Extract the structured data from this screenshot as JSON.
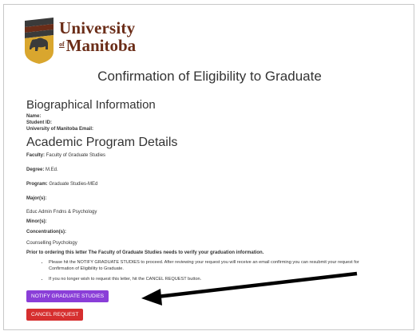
{
  "logo": {
    "line1": "University",
    "of": "of",
    "line2": "Manitoba",
    "colors": {
      "brown": "#6b2d18",
      "gold": "#d9a62e",
      "dark": "#333333"
    },
    "icon": "bison-crest-icon"
  },
  "page_title": "Confirmation of Eligibility to Graduate",
  "bio": {
    "heading": "Biographical Information",
    "name_label": "Name:",
    "student_id_label": "Student ID:",
    "email_label": "University of Manitoba Email:"
  },
  "program": {
    "heading": "Academic Program Details",
    "faculty_label": "Faculty:",
    "faculty_value": "Faculty of Graduate Studies",
    "degree_label": "Degree:",
    "degree_value": "M.Ed.",
    "program_label": "Program:",
    "program_value": "Graduate Studies-MEd",
    "majors_label": "Major(s):",
    "majors_value": "Educ Admin Fndns & Psychology",
    "minors_label": "Minor(s):",
    "concentrations_label": "Concentration(s):",
    "concentrations_value": "Counselling Psychology"
  },
  "notice": "Prior to ordering this letter The Faculty of Graduate Studies needs to verify your graduation information.",
  "instructions": [
    "Please hit the NOTIFY GRADUATE STUDIES to proceed. After reviewing your request you will receive an email confirming you can resubmit your request for Confirmation of Eligibility to Graduate.",
    "If you no longer wish to request this letter, hit the CANCEL REQUEST button."
  ],
  "buttons": {
    "notify": "NOTIFY GRADUATE STUDIES",
    "cancel": "CANCEL REQUEST"
  },
  "colors": {
    "notify_button": "#8a3ed8",
    "cancel_button": "#d62f2f",
    "annotation_arrow": "#000000"
  },
  "annotation": "arrow-icon pointing to notify button"
}
